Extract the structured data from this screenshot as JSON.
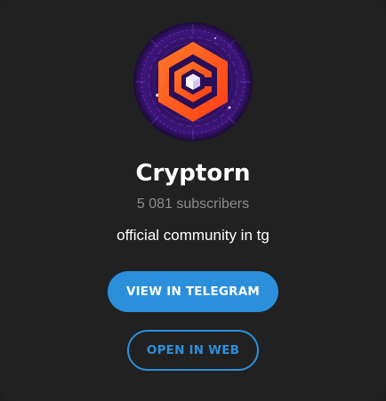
{
  "channel": {
    "name": "Cryptorn",
    "subscribers": "5 081 subscribers",
    "description": "official community in tg",
    "avatar_icon": "cryptorn-logo-icon"
  },
  "actions": {
    "view_label": "VIEW IN TELEGRAM",
    "web_label": "OPEN IN WEB"
  },
  "colors": {
    "background": "#212121",
    "accent": "#2b8fdc",
    "logo_orange": "#ff5a1f",
    "logo_glow": "#7a2bd6"
  }
}
